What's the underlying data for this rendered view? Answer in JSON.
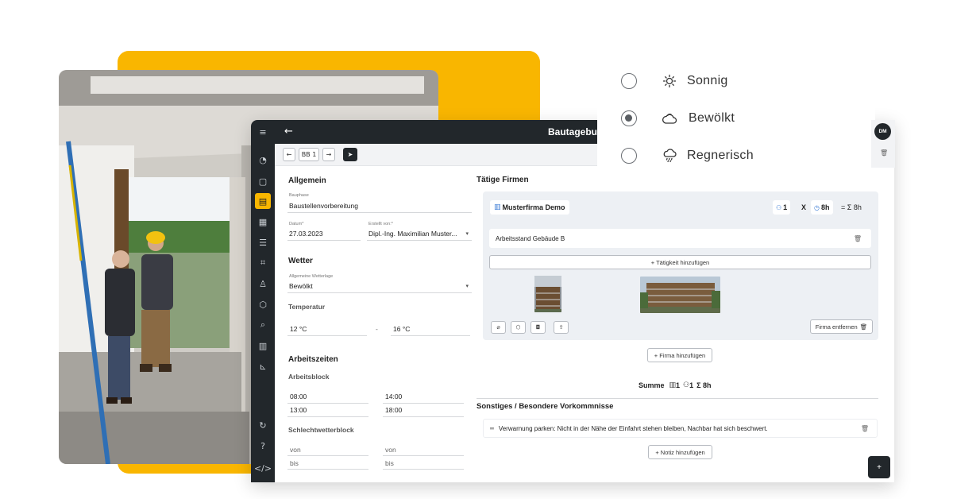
{
  "app": {
    "title": "Bautagebuch",
    "toolbar": {
      "entry_label": "BB 1"
    }
  },
  "allgemein": {
    "heading": "Allgemein",
    "bauphase": {
      "label": "Bauphase",
      "value": "Baustellenvorbereitung"
    },
    "datum": {
      "label": "Datum*",
      "value": "27.03.2023"
    },
    "erstellt_von": {
      "label": "Erstellt von:*",
      "value": "Dipl.-Ing. Maximilian Muster..."
    }
  },
  "wetter": {
    "heading": "Wetter",
    "wetterlage": {
      "label": "Allgemeine Wetterlage",
      "value": "Bewölkt"
    },
    "temperatur_label": "Temperatur",
    "temp_min": "12 °C",
    "temp_separator": "-",
    "temp_max": "16 °C"
  },
  "arbeitszeiten": {
    "heading": "Arbeitszeiten",
    "arbeitsblock_label": "Arbeitsblock",
    "arbeitsblock": [
      {
        "von": "08:00",
        "bis": "14:00"
      },
      {
        "von": "13:00",
        "bis": "18:00"
      }
    ],
    "schlechtwetter_label": "Schlechtwetterblock",
    "schlechtwetter": {
      "von1": "von",
      "von2": "von",
      "bis1": "bis",
      "bis2": "bis"
    }
  },
  "firmen": {
    "heading": "Tätige Firmen",
    "firma_name": "Musterfirma Demo",
    "workers": "1",
    "multiply": "X",
    "hours": "8h",
    "sum": "= Σ 8h",
    "taetigkeit": "Arbeitsstand Gebäude B",
    "add_taetigkeit": "+ Tätigkeit hinzufügen",
    "remove_firma": "Firma entfernen",
    "add_firma": "+ Firma hinzufügen"
  },
  "summe": {
    "label": "Summe",
    "firms": "1",
    "workers": "1",
    "hours": "Σ 8h"
  },
  "sonstiges": {
    "heading": "Sonstiges / Besondere Vorkommnisse",
    "note": "Verwarnung parken: Nicht in der Nähe der Einfahrt stehen bleiben, Nachbar hat sich beschwert.",
    "add_note": "+ Notiz hinzufügen"
  },
  "weather_options": [
    {
      "label": "Sonnig",
      "icon": "sun-icon",
      "checked": false
    },
    {
      "label": "Bewölkt",
      "icon": "cloud-icon",
      "checked": true
    },
    {
      "label": "Regnerisch",
      "icon": "rain-icon",
      "checked": false
    }
  ],
  "user": {
    "initials": "DM"
  },
  "fab_label": "+",
  "colors": {
    "accent": "#f9b600",
    "dark": "#22272b",
    "card": "#edf0f4",
    "link_blue": "#3a7bd5"
  }
}
